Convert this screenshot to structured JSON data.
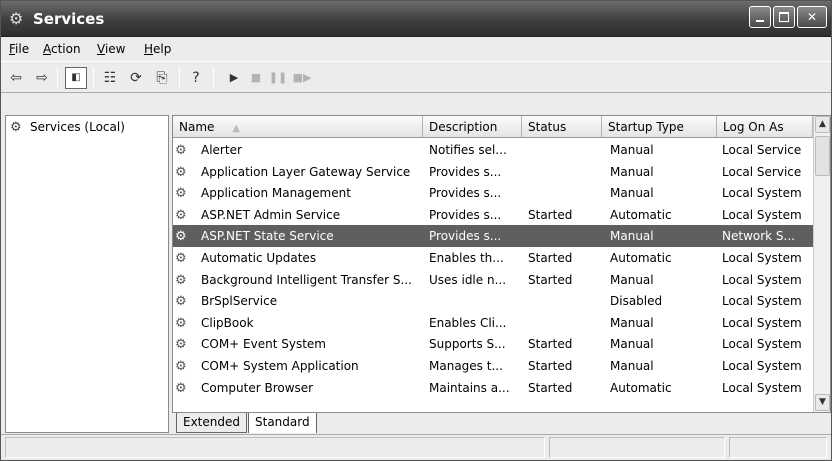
{
  "window": {
    "title": "Services",
    "icon": "services-gear-icon"
  },
  "menu": [
    "File",
    "Action",
    "View",
    "Help"
  ],
  "toolbar": {
    "back": "back-arrow-icon",
    "forward": "forward-arrow-icon",
    "show_hide_tree": "show-hide-console-tree-icon",
    "properties": "properties-icon",
    "refresh": "refresh-icon",
    "export_list": "export-list-icon",
    "help": "help-icon",
    "start": "start-service-icon",
    "stop": "stop-service-icon",
    "pause": "pause-service-icon",
    "restart": "restart-service-icon"
  },
  "tree": {
    "root": "Services (Local)"
  },
  "list": {
    "columns": [
      "Name",
      "Description",
      "Status",
      "Startup Type",
      "Log On As"
    ],
    "sort_indicator": "▲",
    "selected_index": 4,
    "rows": [
      {
        "name": "Alerter",
        "description": "Notifies sel...",
        "status": "",
        "startup": "Manual",
        "logon": "Local Service"
      },
      {
        "name": "Application Layer Gateway Service",
        "description": "Provides s...",
        "status": "",
        "startup": "Manual",
        "logon": "Local Service"
      },
      {
        "name": "Application Management",
        "description": "Provides s...",
        "status": "",
        "startup": "Manual",
        "logon": "Local System"
      },
      {
        "name": "ASP.NET Admin Service",
        "description": "Provides s...",
        "status": "Started",
        "startup": "Automatic",
        "logon": "Local System"
      },
      {
        "name": "ASP.NET State Service",
        "description": "Provides s...",
        "status": "",
        "startup": "Manual",
        "logon": "Network S..."
      },
      {
        "name": "Automatic Updates",
        "description": "Enables th...",
        "status": "Started",
        "startup": "Automatic",
        "logon": "Local System"
      },
      {
        "name": "Background Intelligent Transfer S...",
        "description": "Uses idle n...",
        "status": "Started",
        "startup": "Manual",
        "logon": "Local System"
      },
      {
        "name": "BrSplService",
        "description": "",
        "status": "",
        "startup": "Disabled",
        "logon": "Local System"
      },
      {
        "name": "ClipBook",
        "description": "Enables Cli...",
        "status": "",
        "startup": "Manual",
        "logon": "Local System"
      },
      {
        "name": "COM+ Event System",
        "description": "Supports S...",
        "status": "Started",
        "startup": "Manual",
        "logon": "Local System"
      },
      {
        "name": "COM+ System Application",
        "description": "Manages t...",
        "status": "Started",
        "startup": "Manual",
        "logon": "Local System"
      },
      {
        "name": "Computer Browser",
        "description": "Maintains a...",
        "status": "Started",
        "startup": "Automatic",
        "logon": "Local System"
      }
    ]
  },
  "tabs": [
    "Extended",
    "Standard"
  ],
  "active_tab": "Standard"
}
